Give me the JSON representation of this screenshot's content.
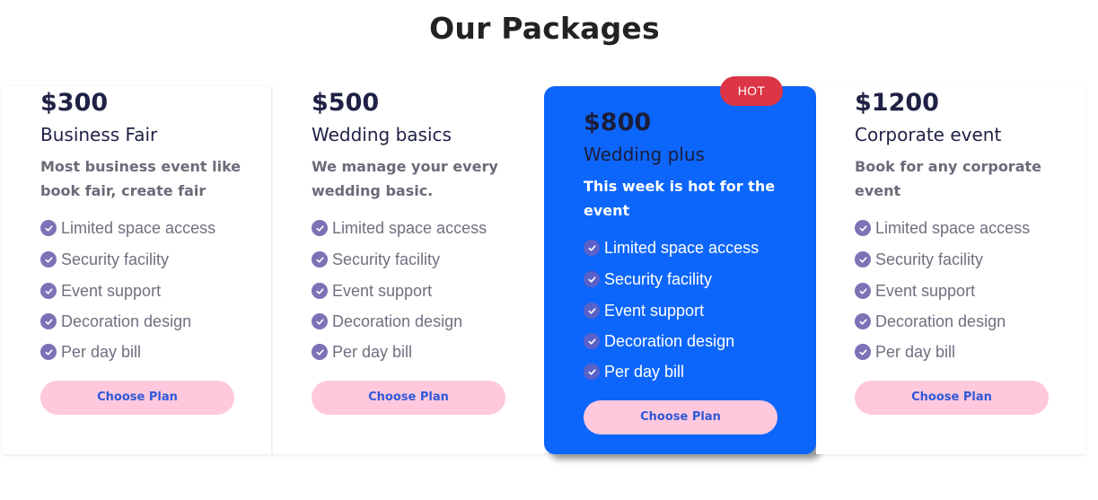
{
  "page": {
    "title": "Our Packages"
  },
  "packages": [
    {
      "price": "$300",
      "name": "Business Fair",
      "description": "Most business event like book fair, create fair",
      "features": [
        "Limited space access",
        "Security facility",
        "Event support",
        "Decoration design",
        "Per day bill"
      ],
      "button_label": "Choose Plan"
    },
    {
      "price": "$500",
      "name": "Wedding basics",
      "description": "We manage your every wedding basic.",
      "features": [
        "Limited space access",
        "Security facility",
        "Event support",
        "Decoration design",
        "Per day bill"
      ],
      "button_label": "Choose Plan"
    },
    {
      "price": "$800",
      "name": "Wedding plus",
      "description": "This week is hot for the event",
      "features": [
        "Limited space access",
        "Security facility",
        "Event support",
        "Decoration design",
        "Per day bill"
      ],
      "button_label": "Choose Plan",
      "badge": "HOT"
    },
    {
      "price": "$1200",
      "name": "Corporate event",
      "description": "Book for any corporate event",
      "features": [
        "Limited space access",
        "Security facility",
        "Event support",
        "Decoration design",
        "Per day bill"
      ],
      "button_label": "Choose Plan"
    }
  ],
  "icons": {
    "feature": "check-circle-icon"
  },
  "colors": {
    "hot_card_bg": "#0d66fb",
    "badge_bg": "#dc3545",
    "button_bg": "#ffc8dc",
    "button_text": "#2f59d9",
    "check_icon": "#7e71b6",
    "heading": "#1f2145"
  }
}
